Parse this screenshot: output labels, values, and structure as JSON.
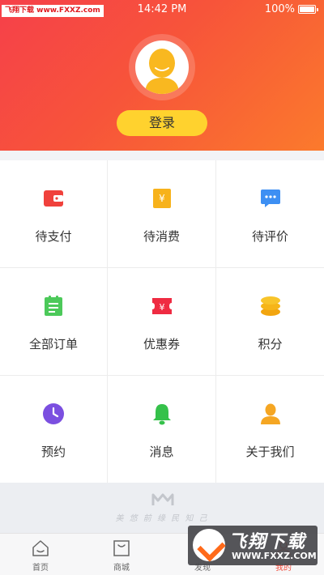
{
  "status_bar": {
    "site_watermark": "飞翔下载 www.FXXZ.com",
    "time": "14:42 PM",
    "battery": "100%"
  },
  "profile": {
    "login_label": "登录"
  },
  "grid_items": [
    {
      "label": "待支付",
      "icon": "wallet-icon"
    },
    {
      "label": "待消费",
      "icon": "yen-card-icon"
    },
    {
      "label": "待评价",
      "icon": "chat-bubble-icon"
    },
    {
      "label": "全部订单",
      "icon": "order-list-icon"
    },
    {
      "label": "优惠券",
      "icon": "coupon-icon"
    },
    {
      "label": "积分",
      "icon": "coins-icon"
    },
    {
      "label": "预约",
      "icon": "clock-icon"
    },
    {
      "label": "消息",
      "icon": "bell-icon"
    },
    {
      "label": "关于我们",
      "icon": "person-icon"
    }
  ],
  "brand": {
    "slogan": "美 悠 前 缘 民 知 己"
  },
  "tab_bar": {
    "tabs": [
      {
        "label": "首页",
        "icon": "home-icon"
      },
      {
        "label": "商城",
        "icon": "shopping-bag-icon"
      },
      {
        "label": "发现",
        "icon": "discover-icon"
      },
      {
        "label": "我的",
        "icon": "profile-icon"
      }
    ],
    "active_tab": "我的"
  },
  "overlay_watermark": {
    "title": "飞翔下载",
    "url": "WWW.FXXZ.COM"
  },
  "colors": {
    "header_start": "#f6404a",
    "header_end": "#fb7a2c",
    "login_button": "#ffd22e"
  }
}
